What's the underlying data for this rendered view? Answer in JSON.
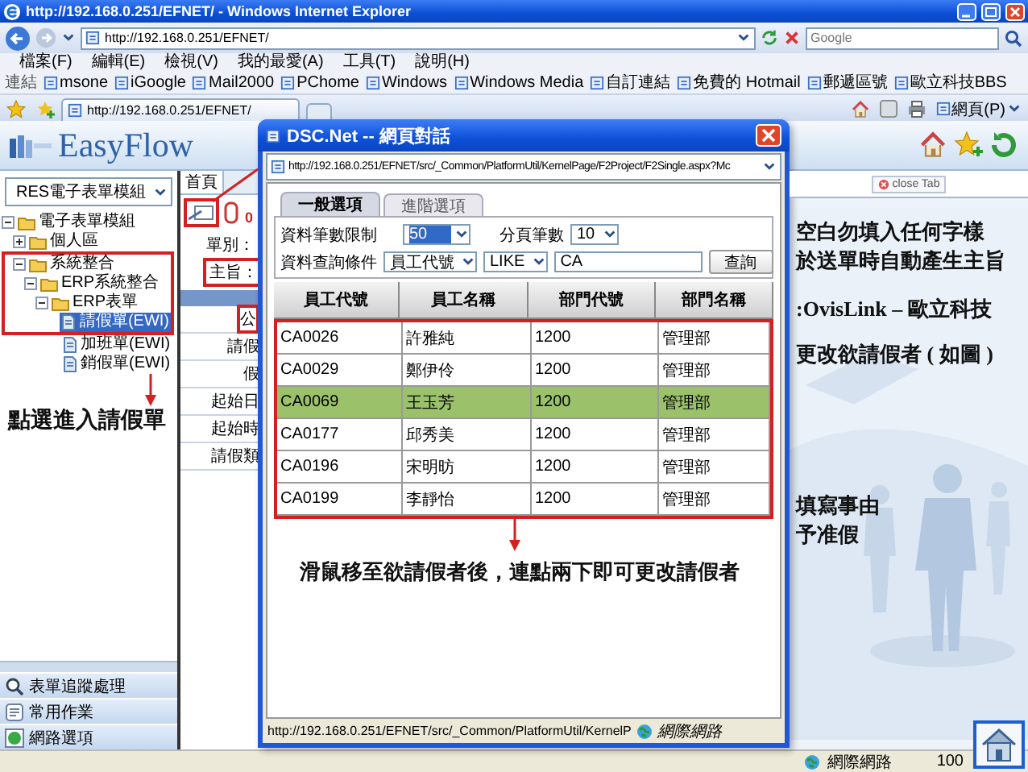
{
  "browser": {
    "title": "http://192.168.0.251/EFNET/ - Windows Internet Explorer",
    "address": "http://192.168.0.251/EFNET/",
    "search_placeholder": "Google",
    "menu": [
      "檔案(F)",
      "編輯(E)",
      "檢視(V)",
      "我的最愛(A)",
      "工具(T)",
      "說明(H)"
    ],
    "links_label": "連結",
    "links": [
      "msone",
      "iGoogle",
      "Mail2000",
      "PChome",
      "Windows",
      "Windows Media",
      "自訂連結",
      "免費的 Hotmail",
      "郵遞區號",
      "歐立科技BBS"
    ],
    "tab": "http://192.168.0.251/EFNET/",
    "page_menu": "網頁(P)",
    "status_zone": "網際網路",
    "zoom": "100"
  },
  "app": {
    "logo": "EasyFlow",
    "module": "RES電子表單模組",
    "tree": [
      {
        "label": "電子表單模組",
        "kind": "folder",
        "expanded": true,
        "selected": false,
        "children": [
          {
            "label": "個人區",
            "kind": "folder",
            "expanded": false,
            "selected": false
          },
          {
            "label": "系統整合",
            "kind": "folder",
            "expanded": true,
            "selected": false,
            "children": [
              {
                "label": "ERP系統整合",
                "kind": "folder",
                "expanded": true,
                "selected": false,
                "children": [
                  {
                    "label": "ERP表單",
                    "kind": "folder",
                    "expanded": true,
                    "selected": false,
                    "children": [
                      {
                        "label": "請假單(EWI)",
                        "kind": "form",
                        "selected": true
                      },
                      {
                        "label": "加班單(EWI)",
                        "kind": "form",
                        "selected": false
                      },
                      {
                        "label": "銷假單(EWI)",
                        "kind": "form",
                        "selected": false
                      }
                    ]
                  }
                ]
              }
            ]
          }
        ]
      }
    ],
    "panels": [
      "表單追蹤處理",
      "常用作業",
      "網路選項"
    ],
    "home_tab": "首頁",
    "close_tab": "close Tab",
    "toolbar_count": "0",
    "form_labels": [
      "單別：",
      "主旨："
    ],
    "row_labels": [
      "公",
      "請假",
      "假",
      "起始日",
      "起始時",
      "請假類"
    ],
    "notes": [
      "空白勿填入任何字樣",
      "於送單時自動產生主旨",
      ":OvisLink – 歐立科技",
      "更改欲請假者 ( 如圖 )",
      "填寫事由",
      "予准假"
    ]
  },
  "dialog": {
    "title": "DSC.Net -- 網頁對話",
    "address": "http://192.168.0.251/EFNET/src/_Common/PlatformUtil/KernelPage/F2Project/F2Single.aspx?Mc",
    "tabs": [
      {
        "label": "一般選項",
        "selected": true
      },
      {
        "label": "進階選項",
        "selected": false
      }
    ],
    "fields": {
      "limit_label": "資料筆數限制",
      "limit": "50",
      "page_label": "分頁筆數",
      "page_size": "10",
      "query_label": "資料查詢條件",
      "query_field": "員工代號",
      "operator": "LIKE",
      "query": "CA",
      "search_button": "查詢"
    },
    "table": {
      "columns": [
        "員工代號",
        "員工名稱",
        "部門代號",
        "部門名稱"
      ],
      "rows": [
        {
          "cells": [
            "CA0026",
            "許雅純",
            "1200",
            "管理部"
          ],
          "selected": false
        },
        {
          "cells": [
            "CA0029",
            "鄭伊伶",
            "1200",
            "管理部"
          ],
          "selected": false
        },
        {
          "cells": [
            "CA0069",
            "王玉芳",
            "1200",
            "管理部"
          ],
          "selected": true
        },
        {
          "cells": [
            "CA0177",
            "邱秀美",
            "1200",
            "管理部"
          ],
          "selected": false
        },
        {
          "cells": [
            "CA0196",
            "宋明昉",
            "1200",
            "管理部"
          ],
          "selected": false
        },
        {
          "cells": [
            "CA0199",
            "李靜怡",
            "1200",
            "管理部"
          ],
          "selected": false
        }
      ]
    },
    "status": "http://192.168.0.251/EFNET/src/_Common/PlatformUtil/KernelP",
    "status_zone": "網際網路"
  },
  "annotations": [
    "點選進入請假單",
    "滑鼠移至欲請假者後，連點兩下即可更改請假者"
  ]
}
